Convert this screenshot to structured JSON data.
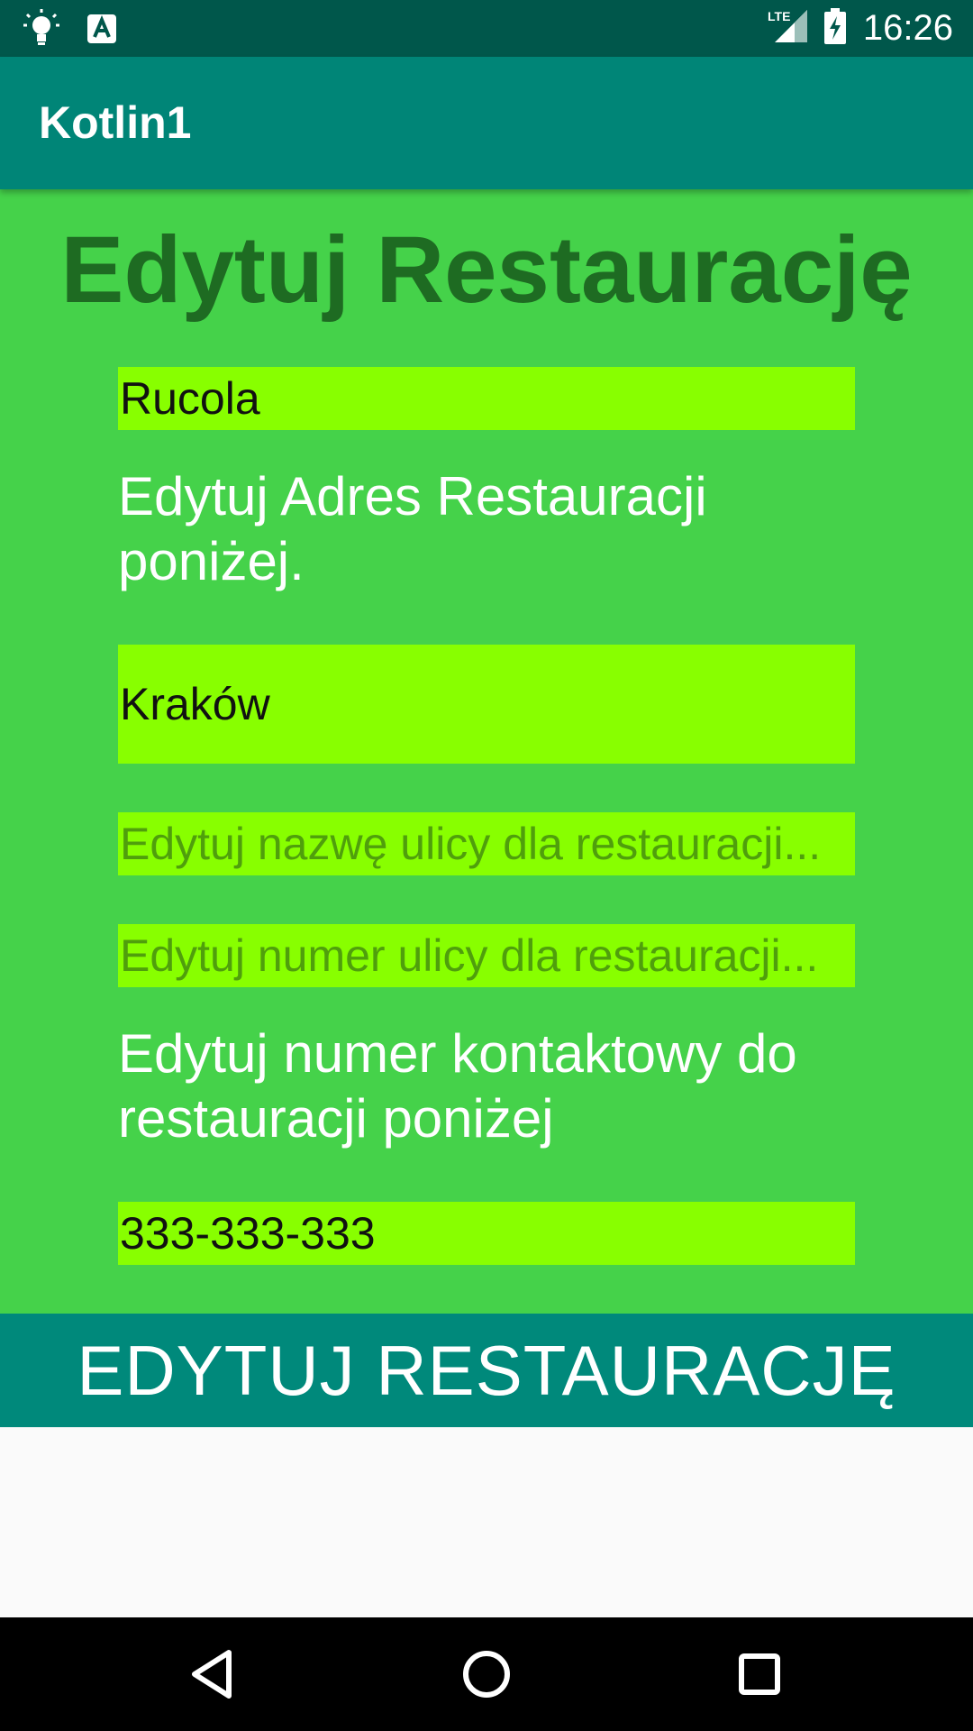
{
  "status_bar": {
    "time": "16:26",
    "network": "LTE",
    "icons": [
      "lightbulb-icon",
      "a-badge-icon",
      "signal-icon",
      "battery-charging-icon"
    ]
  },
  "app_bar": {
    "title": "Kotlin1"
  },
  "main": {
    "heading": "Edytuj Restaurację",
    "name_field": {
      "value": "Rucola"
    },
    "address_label": "Edytuj Adres Restauracji poniżej.",
    "city_field": {
      "value": "Kraków"
    },
    "street_field": {
      "placeholder": "Edytuj nazwę ulicy dla restauracji..."
    },
    "street_number_field": {
      "placeholder": "Edytuj numer ulicy dla restauracji..."
    },
    "contact_label": "Edytuj numer kontaktowy do restauracji poniżej",
    "phone_field": {
      "value": "333-333-333"
    }
  },
  "submit_button": {
    "label": "EDYTUJ RESTAURACJĘ"
  },
  "nav_bar": {
    "icons": [
      "back-icon",
      "home-icon",
      "recents-icon"
    ]
  },
  "colors": {
    "status_bar": "#00574b",
    "app_bar": "#008577",
    "content_background": "#45d24a",
    "field_background": "#88ff00",
    "heading": "#1e6b22",
    "button": "#00897b"
  }
}
